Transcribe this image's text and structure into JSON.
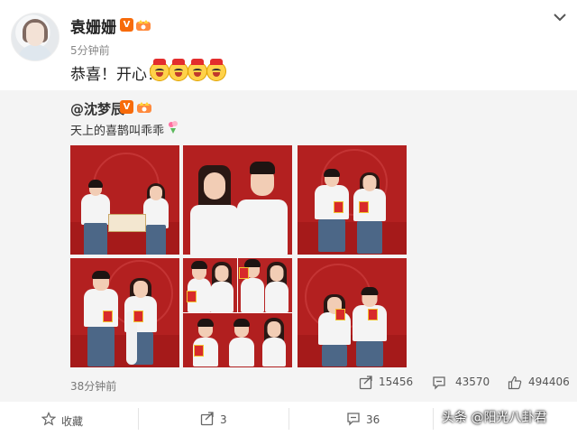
{
  "post": {
    "author": "袁姗姗",
    "time": "5分钟前",
    "text": "恭喜！开心！",
    "emoji_icon": "cheer-emoji-icon",
    "emoji_count": 4
  },
  "repost": {
    "author": "@沈梦辰",
    "text": "天上的喜鹊叫乖乖",
    "time": "38分钟前",
    "stats": {
      "reposts": "15456",
      "comments": "43570",
      "likes": "494406"
    },
    "photos": [
      {
        "scene": "couple standing by wedding sign"
      },
      {
        "scene": "couple portrait close-up"
      },
      {
        "scene": "couple holding red certificates"
      },
      {
        "scene": "couple holding certificates with plush toy"
      },
      {
        "scene": "photo-booth collage"
      },
      {
        "scene": "couple holding certificates near cheeks"
      }
    ]
  },
  "actions": {
    "favorite_label": "收藏",
    "repost_count": "3",
    "comment_count": "36"
  },
  "watermark": "头条 @阳光八卦君",
  "colors": {
    "verified_badge": "#f76b0b",
    "photo_background": "#b51f1f",
    "repost_panel": "#f4f4f4"
  }
}
